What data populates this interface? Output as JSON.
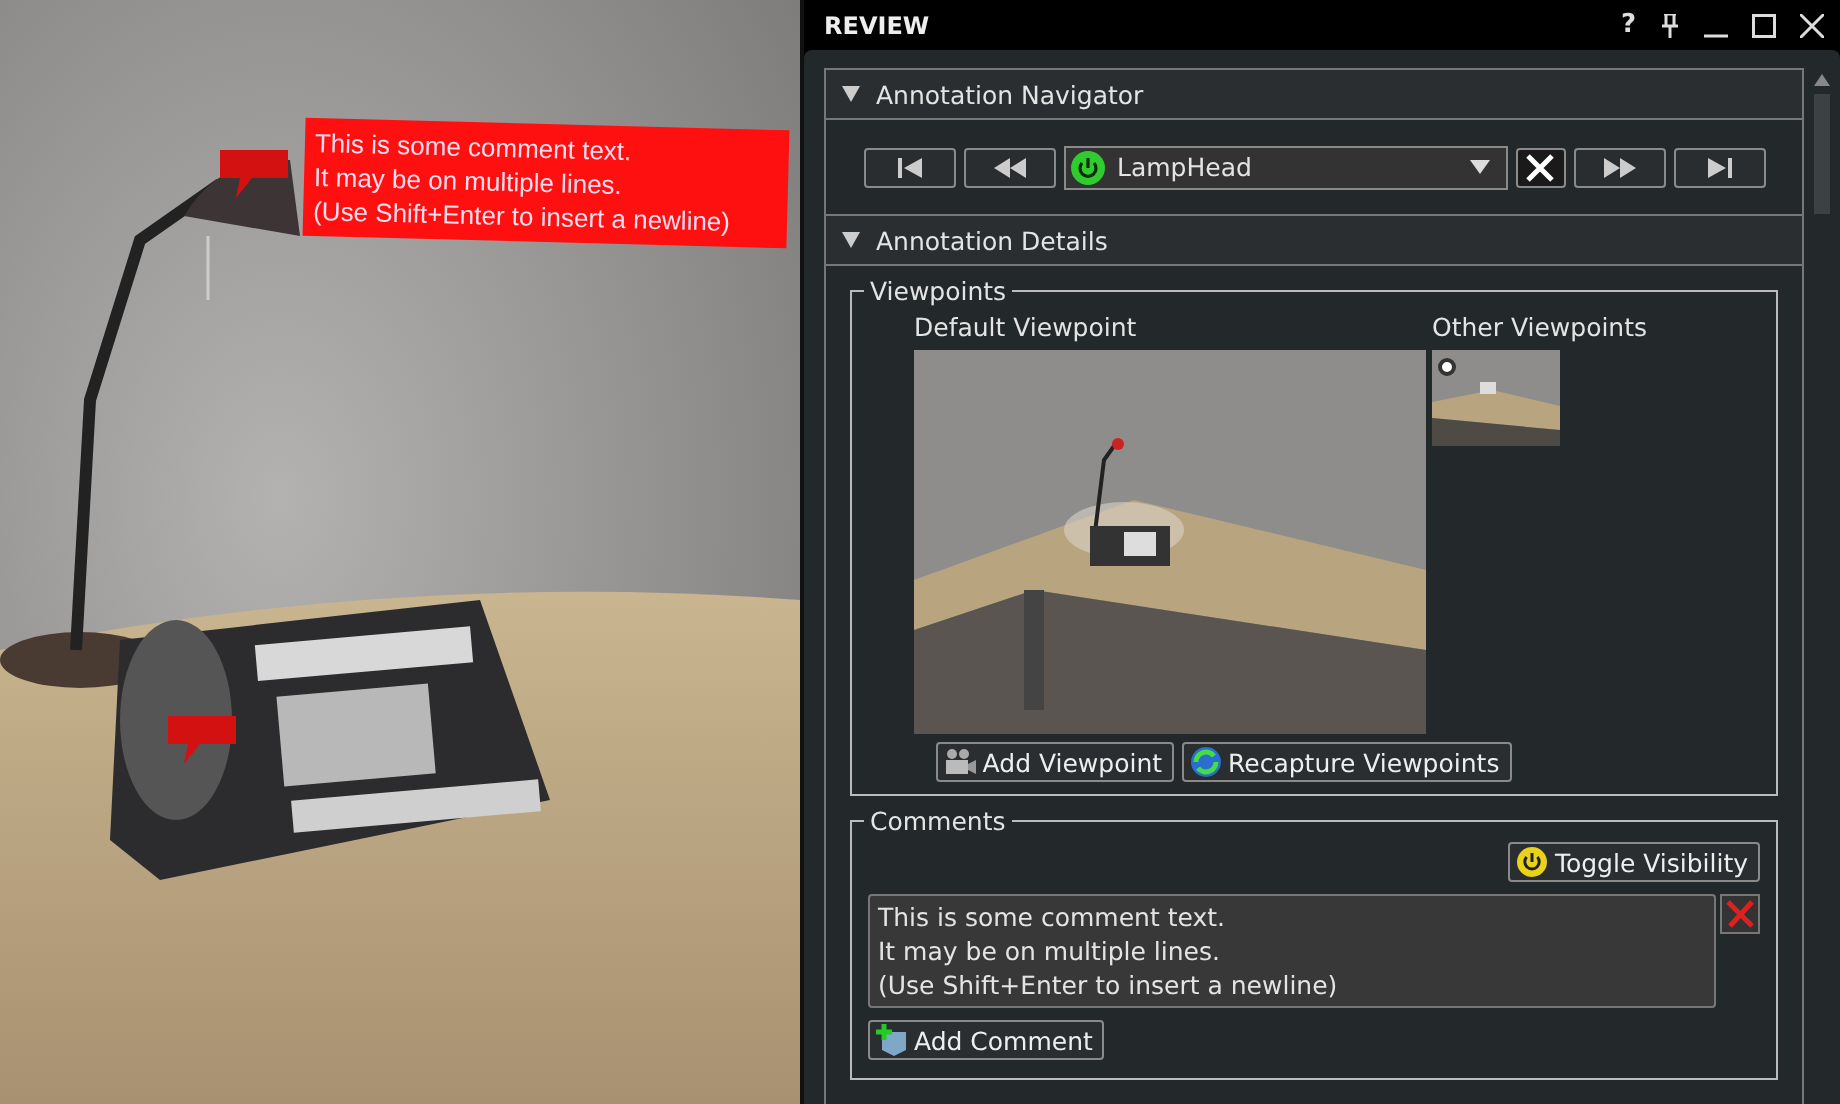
{
  "viewport": {
    "callout": {
      "text": "This is some comment text.\nIt may be on multiple lines.\n(Use Shift+Enter to insert a newline)"
    }
  },
  "panel": {
    "title": "REVIEW",
    "help": "?"
  },
  "navigator": {
    "title": "Annotation Navigator",
    "expanded": true,
    "annotation": {
      "value": "LampHead",
      "visible": true
    }
  },
  "details": {
    "title": "Annotation Details",
    "expanded": true,
    "viewpoints": {
      "legend": "Viewpoints",
      "default_label": "Default Viewpoint",
      "other_label": "Other Viewpoints",
      "others": [
        {
          "selected": true
        }
      ],
      "buttons": [
        "Add Viewpoint",
        "Recapture Viewpoints"
      ]
    },
    "comments": {
      "legend": "Comments",
      "toggle": "Toggle Visibility",
      "items": [
        {
          "text": "This is some comment text.\nIt may be on multiple lines.\n(Use Shift+Enter to insert a newline)"
        }
      ],
      "add": "Add Comment"
    }
  }
}
